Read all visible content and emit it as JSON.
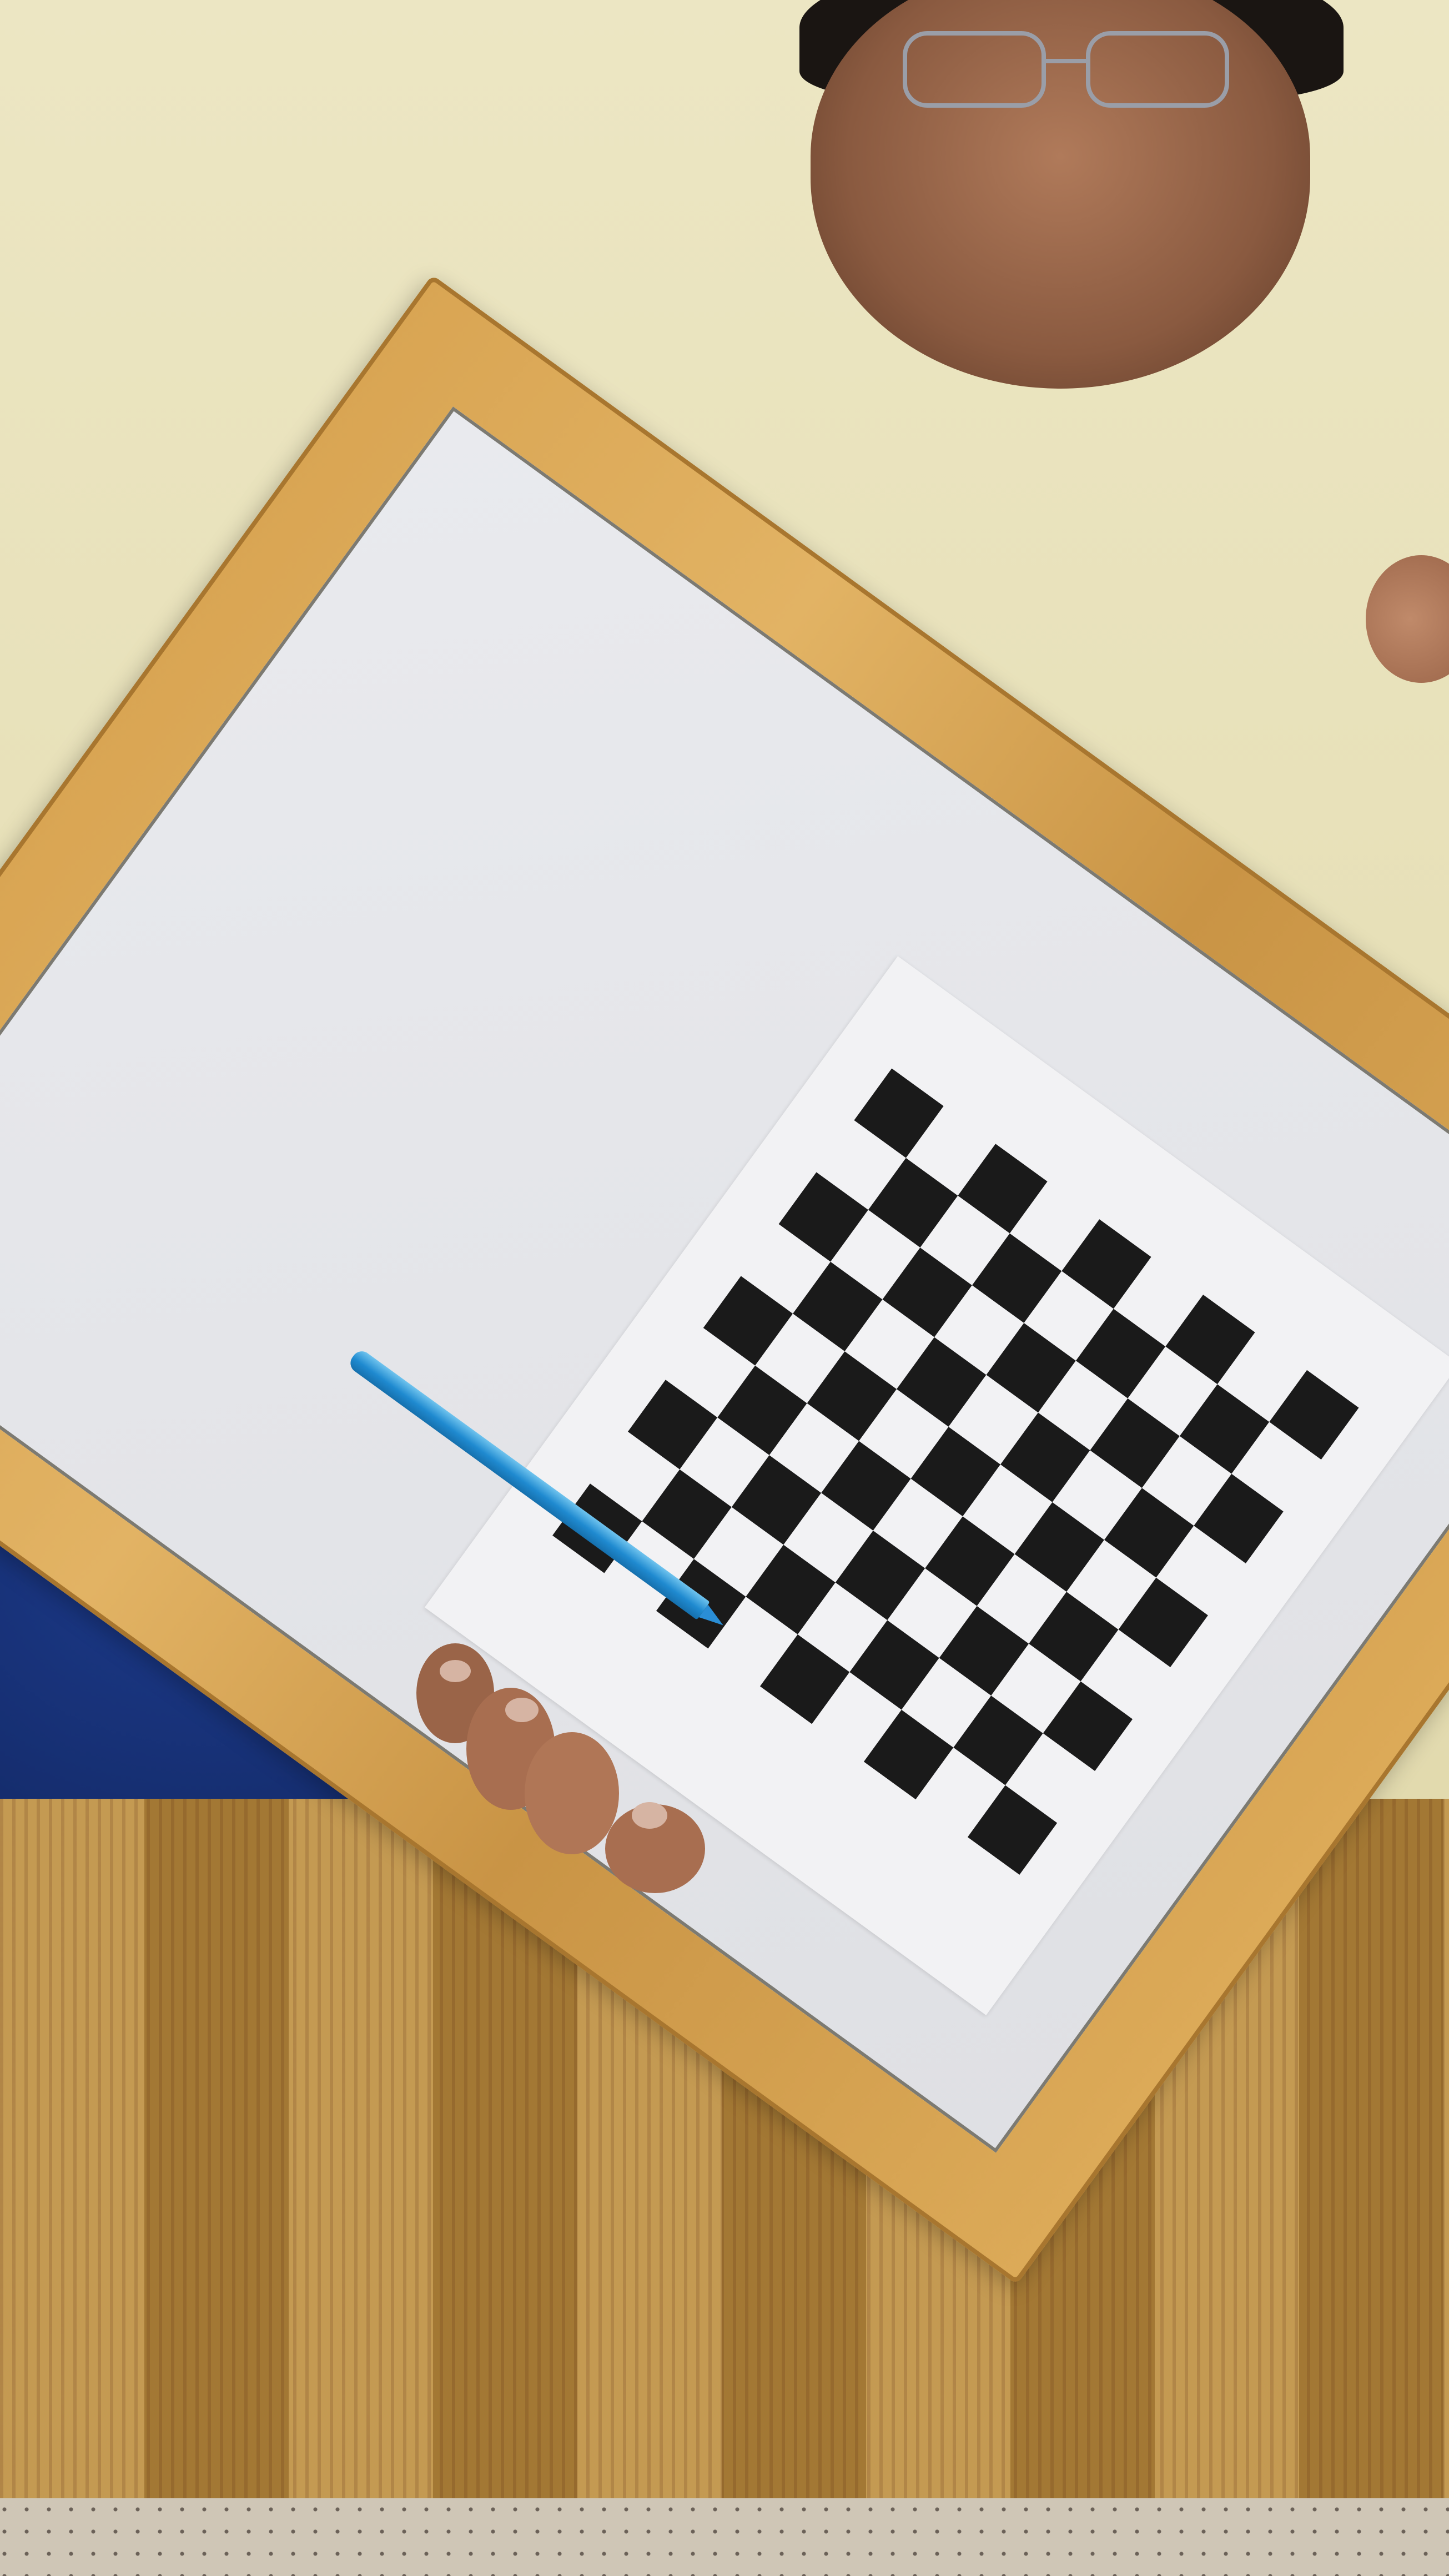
{
  "scene": {
    "description_label": "",
    "colors": {
      "wall": "#e6dfb6",
      "frame_wood": "#d9a553",
      "whiteboard": "#e4e5e9",
      "paper": "#f2f2f4",
      "checker_dark": "#1a1a1a",
      "checker_light": "#f2f2f4",
      "pen": "#1f8ad0",
      "pants": "#152d6e",
      "tablecloth_light": "#c49a52",
      "tablecloth_dark": "#7a4326"
    },
    "checkerboard": {
      "rows": 9,
      "cols": 9
    }
  }
}
